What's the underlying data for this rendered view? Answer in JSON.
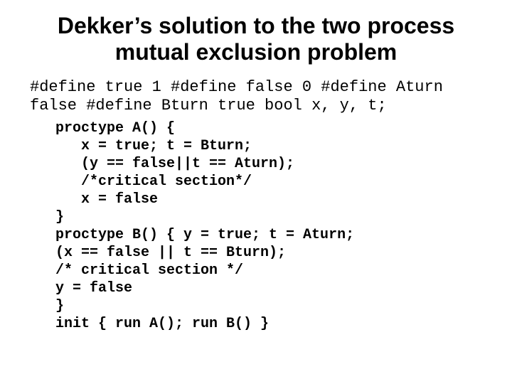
{
  "title": "Dekker’s solution to the two process mutual exclusion problem",
  "defines": "#define true 1 #define false 0 #define Aturn\nfalse #define Bturn true bool x, y, t;",
  "code": "proctype A() {\n   x = true; t = Bturn;\n   (y == false||t == Aturn);\n   /*critical section*/\n   x = false\n}\nproctype B() { y = true; t = Aturn;\n(x == false || t == Bturn);\n/* critical section */\ny = false\n}\ninit { run A(); run B() }"
}
